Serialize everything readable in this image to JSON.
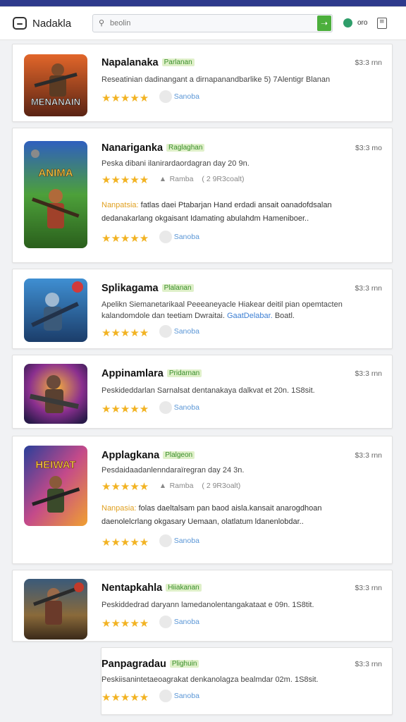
{
  "header": {
    "brand": "Nadakla",
    "search_placeholder": "beolin",
    "search_button_icon": "search-arrow-icon",
    "status_label": "oro",
    "colors": {
      "top_strip": "#2e3a8c",
      "search_button": "#4caf3c",
      "status": "#2f9e6a",
      "star": "#f2b323",
      "tag_bg": "#dff0c9",
      "tag_text": "#3b8f2c"
    }
  },
  "apps": [
    {
      "title": "Napalanaka",
      "tag": "Parlanan",
      "price": "$3:3 rnn",
      "desc": "Reseatinian dadinangant a dirnapanandbarlike 5) 7Alentigr Blanan",
      "stars": "★★★★★",
      "review_label": "Sanoba",
      "thumb_text": "MENANAIN"
    },
    {
      "title": "Nanariganka",
      "tag": "Raglaghan",
      "price": "$3:3 mo",
      "desc": "Peska dibani  ilanirardaordagran day 20 9n.",
      "stars": "★★★★★",
      "meta_label": "Ramba",
      "meta_value": "( 2 9R3coalt)",
      "note_label": "Nanpatsia:",
      "note_text": "fatlas daei Ptabarjan Hand erdadi ansait oanadofdsalan",
      "note_line2": "dedanakarlang okgaisant Idamating abulahdm Hameniboer..",
      "stars2": "★★★★★",
      "review_label": "Sanoba",
      "thumb_text": "ANIMA"
    },
    {
      "title": "Splikagama",
      "tag": "Plalanan",
      "price": "$3:3 rnn",
      "desc": "Apelikn Siemanetarikaal Peeeaneyacle Hiakear deitil pian opemtacten",
      "desc2": "kalandomdole dan teetiam Dwraitai.",
      "desc2_link": "GaatDelabar.",
      "desc2_tail": "Boatl.",
      "stars": "★★★★★",
      "review_label": "Sanoba",
      "thumb_text": ""
    },
    {
      "title": "Appinamlara",
      "tag": "Pridarnan",
      "price": "$3:3 rnn",
      "desc": "Peskideddarlan Sarnalsat dentanakaya dalkvat et 20n. 1S8sit.",
      "stars": "★★★★★",
      "review_label": "Sanoba",
      "thumb_text": ""
    },
    {
      "title": "Applagkana",
      "tag": "Plalgeon",
      "price": "$3:3 rnn",
      "desc": "Pesdaidaadanlenndaraïregran day 24 3n.",
      "stars": "★★★★★",
      "meta_label": "Ramba",
      "meta_value": "( 2 9R3oalt)",
      "note_label": "Nanpasia:",
      "note_text": "folas daeltalsam pan baod aisla.kansait anarogdhoan",
      "note_line2": "daenolelcrlang okgasary Uemaan, olatlatum ldanenlobdar..",
      "stars2": "★★★★★",
      "review_label": "Sanoba",
      "thumb_text": "HEIWAT"
    },
    {
      "title": "Nentapkahla",
      "tag": "Hiiakanan",
      "price": "$3:3 rnn",
      "desc": "Peskiddedrad daryann lamedanolentangakataat e 09n. 1S8tit.",
      "stars": "★★★★★",
      "review_label": "Sanoba",
      "thumb_text": ""
    },
    {
      "title": "Panpagradau",
      "tag": "Plighuin",
      "price": "$3:3 rnn",
      "desc": "Peskiisanintetaeoagrakat denkanolagza bealmdar 02m. 1S8sit.",
      "stars": "★★★★★",
      "review_label": "Sanoba"
    }
  ]
}
